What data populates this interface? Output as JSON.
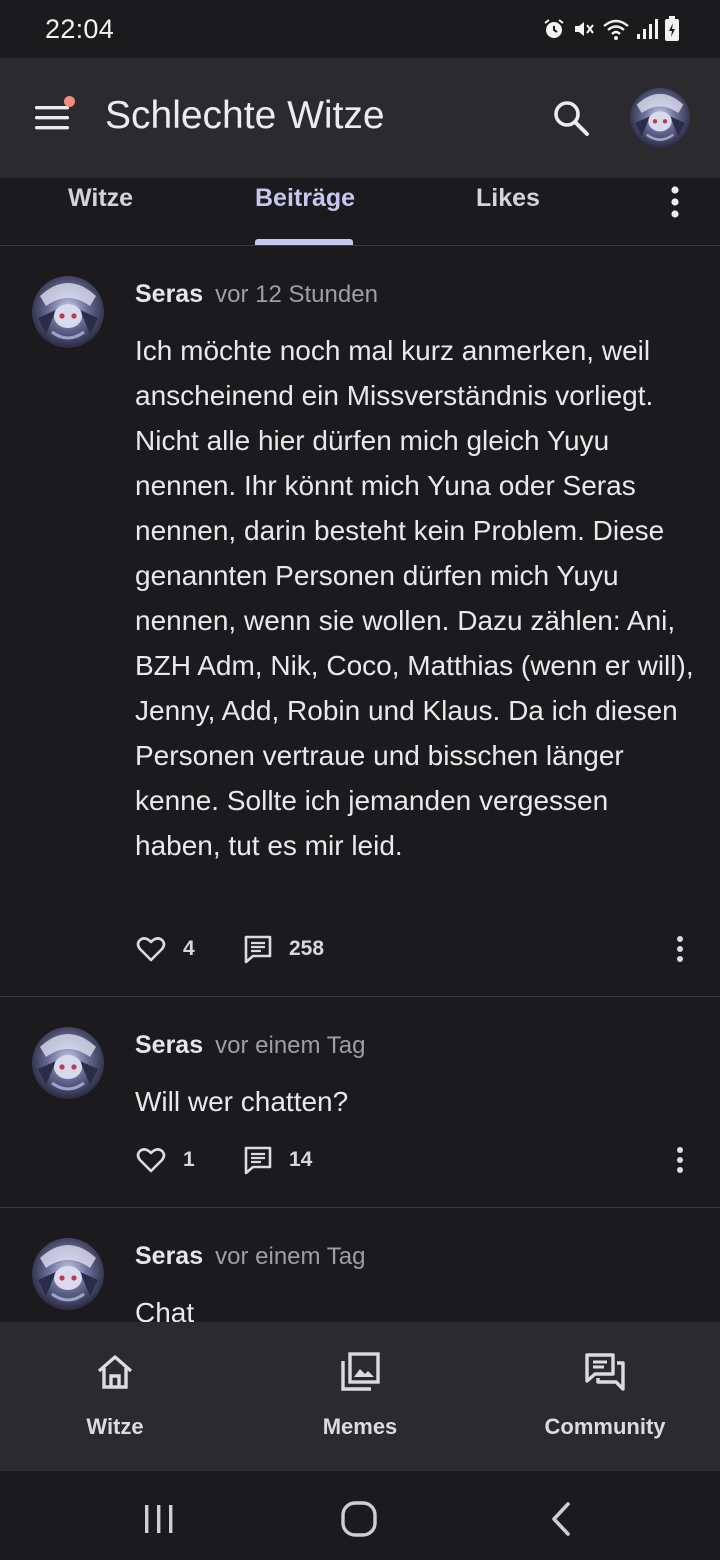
{
  "status_bar": {
    "time": "22:04",
    "icons": [
      "alarm-icon",
      "mute-icon",
      "wifi-icon",
      "signal-icon",
      "battery-charging-icon"
    ]
  },
  "app_bar": {
    "title": "Schlechte Witze",
    "menu_icon": "hamburger-menu-icon",
    "notification_dot_color": "#f28b82",
    "search_icon": "search-icon"
  },
  "tabs": {
    "items": [
      {
        "label": "Witze"
      },
      {
        "label": "Beiträge"
      },
      {
        "label": "Likes"
      }
    ],
    "active": "Beiträge",
    "accent_color": "#c7c6ee"
  },
  "posts": [
    {
      "author": "Seras",
      "time": "vor 12 Stunden",
      "text": "Ich möchte noch mal kurz anmerken, weil anscheinend ein Missverständnis vorliegt. Nicht alle hier dürfen mich gleich Yuyu nennen. Ihr könnt mich Yuna oder Seras nennen, darin besteht kein Problem. Diese genannten Personen dürfen mich Yuyu nennen, wenn sie wollen. Dazu zählen: Ani, BZH Adm, Nik, Coco, Matthias (wenn er will), Jenny, Add, Robin und Klaus. Da ich diesen Personen vertraue und bisschen länger kenne. Sollte ich jemanden vergessen haben, tut es mir leid.",
      "likes": "4",
      "comments": "258"
    },
    {
      "author": "Seras",
      "time": "vor einem Tag",
      "text": "Will wer chatten?",
      "likes": "1",
      "comments": "14"
    },
    {
      "author": "Seras",
      "time": "vor einem Tag",
      "text": "Chat"
    }
  ],
  "bottom_nav": {
    "items": [
      {
        "label": "Witze",
        "icon": "home-icon"
      },
      {
        "label": "Memes",
        "icon": "image-gallery-icon"
      },
      {
        "label": "Community",
        "icon": "forum-icon"
      }
    ]
  },
  "system_nav": {
    "buttons": [
      "recent-apps-icon",
      "home-circle-icon",
      "back-icon"
    ]
  }
}
